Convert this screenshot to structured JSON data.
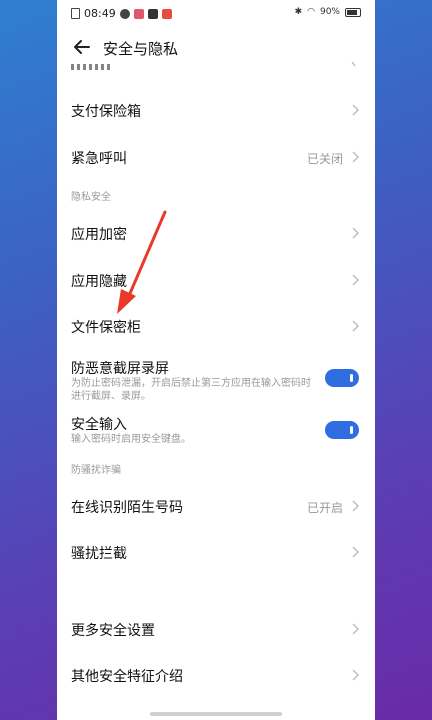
{
  "status": {
    "time": "08:49",
    "battery": "90%"
  },
  "header": {
    "title": "安全与隐私"
  },
  "rows": {
    "payment_box": {
      "label": "支付保险箱"
    },
    "emergency": {
      "label": "紧急呼叫",
      "value": "已关闭"
    },
    "app_encrypt": {
      "label": "应用加密"
    },
    "app_hide": {
      "label": "应用隐藏"
    },
    "file_safe": {
      "label": "文件保密柜"
    },
    "anti_capture": {
      "label": "防恶意截屏录屏",
      "desc": "为防止密码泄漏，开启后禁止第三方应用在输入密码时进行截屏、录屏。"
    },
    "secure_input": {
      "label": "安全输入",
      "desc": "输入密码时启用安全键盘。"
    },
    "stranger_id": {
      "label": "在线识别陌生号码",
      "value": "已开启"
    },
    "harass_block": {
      "label": "骚扰拦截"
    },
    "more_security": {
      "label": "更多安全设置"
    },
    "other_features": {
      "label": "其他安全特征介绍"
    }
  },
  "sections": {
    "privacy": "隐私安全",
    "anti_fraud": "防骚扰诈骗"
  },
  "colors": {
    "accent": "#2f6de0",
    "arrow": "#e8392b"
  },
  "toggles": {
    "anti_capture": true,
    "secure_input": true
  }
}
